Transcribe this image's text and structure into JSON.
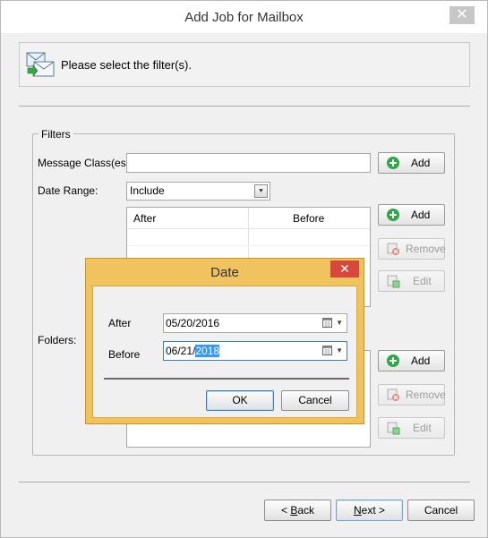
{
  "window": {
    "title": "Add Job for Mailbox",
    "close_glyph": "✕"
  },
  "header": {
    "text": "Please select the filter(s).",
    "icon": "mailbox-filter-icon"
  },
  "filters": {
    "group_title": "Filters",
    "message_class_label": "Message Class(es):",
    "message_class_value": "",
    "date_range_label": "Date Range:",
    "date_range_value": "Include",
    "folders_label": "Folders:",
    "date_columns": [
      "After",
      "Before"
    ],
    "add_label": "Add",
    "remove_label": "Remove",
    "edit_label": "Edit"
  },
  "navigation": {
    "back_prefix": "< ",
    "back_key": "B",
    "back_rest": "ack",
    "next_key": "N",
    "next_rest": "ext >",
    "cancel_label": "Cancel"
  },
  "date_dialog": {
    "title": "Date",
    "close_glyph": "✕",
    "after_label": "After",
    "after_value": "05/20/2016",
    "before_label": "Before",
    "before_value_prefix": "06/21/",
    "before_value_selected": "2018",
    "ok_label": "OK",
    "cancel_label": "Cancel"
  },
  "colors": {
    "dialog_frame": "#f0c35e",
    "dialog_close": "#d9463b",
    "selection": "#3399ff",
    "add_icon": "#2ea64a",
    "remove_icon": "#d9463b"
  }
}
